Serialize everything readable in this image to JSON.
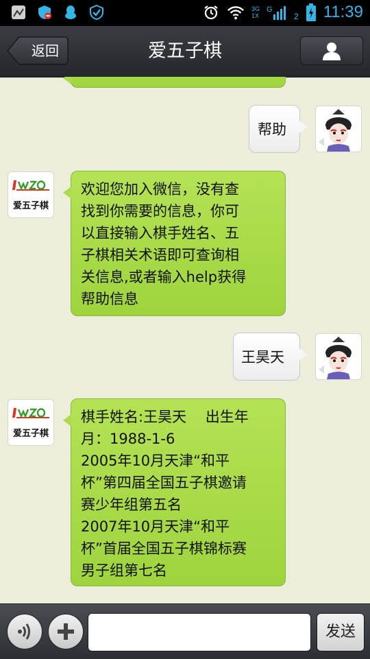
{
  "status_bar": {
    "time": "11:39",
    "network_labels": [
      "3G",
      "1X"
    ],
    "sim_slot": "2",
    "left_icons": [
      "screenshot-icon",
      "security-shield-icon",
      "qq-penguin-icon",
      "shield-check-icon"
    ],
    "right_icons": [
      "alarm-icon",
      "wifi-icon",
      "signal-icon",
      "battery-charging-icon"
    ]
  },
  "header": {
    "back_label": "返回",
    "title": "爱五子棋",
    "profile_icon": "person-icon"
  },
  "chat": {
    "messages": [
      {
        "direction": "in",
        "sender": "爱五子棋",
        "text": ""
      },
      {
        "direction": "out",
        "text": "帮助"
      },
      {
        "direction": "in",
        "sender": "爱五子棋",
        "logo_text": "爱五子棋",
        "lines": [
          "欢迎您加入微信，没有查",
          "找到你需要的信息，你可",
          "以直接输入棋手姓名、五",
          "子棋相关术语即可查询相",
          "关信息,或者输入help获得",
          "帮助信息"
        ]
      },
      {
        "direction": "out",
        "text": "王昊天"
      },
      {
        "direction": "in",
        "sender": "爱五子棋",
        "logo_text": "爱五子棋",
        "lines": [
          "棋手姓名:王昊天　 出生年",
          "月：1988-1-6",
          "2005年10月天津“和平",
          "杯”第四届全国五子棋邀请",
          "赛少年组第五名",
          "2007年10月天津“和平",
          "杯”首届全国五子棋锦标赛",
          "男子组第七名"
        ]
      }
    ]
  },
  "input_bar": {
    "voice_icon": "voice-icon",
    "plus_icon": "plus-icon",
    "input_value": "",
    "input_placeholder": "",
    "send_label": "发送"
  },
  "colors": {
    "incoming_bubble": "#a8dc4a",
    "outgoing_bubble": "#f6f6f6",
    "chat_background": "#ededdc",
    "status_accent": "#33b5e5"
  }
}
